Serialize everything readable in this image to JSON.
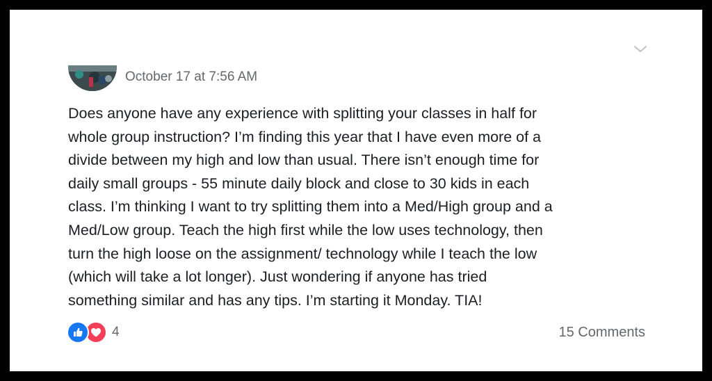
{
  "post": {
    "timestamp": "October 17 at 7:56 AM",
    "text_lines": [
      "Does anyone have any experience with splitting your classes in half for",
      "whole group instruction? I’m finding this year that I have even more of a",
      "divide between my high and low than usual. There isn’t enough time for",
      "daily small groups - 55 minute daily block and close to 30 kids in each",
      "class. I’m thinking I want to try splitting them into a Med/High group and a",
      "Med/Low group. Teach the high first while the low uses technology, then",
      "turn the high loose on the assignment/ technology while I teach the low",
      "(which will take a lot longer). Just wondering if anyone has tried",
      "something similar and has any tips. I’m starting it Monday. TIA!"
    ]
  },
  "footer": {
    "reaction_count": "4",
    "comments": "15 Comments"
  },
  "icons": {
    "menu": "chevron-down-icon",
    "reactions": [
      "like-icon",
      "love-icon"
    ]
  },
  "colors": {
    "like": "#1877f2",
    "love": "#f33e58",
    "secondary_text": "#65676b"
  }
}
